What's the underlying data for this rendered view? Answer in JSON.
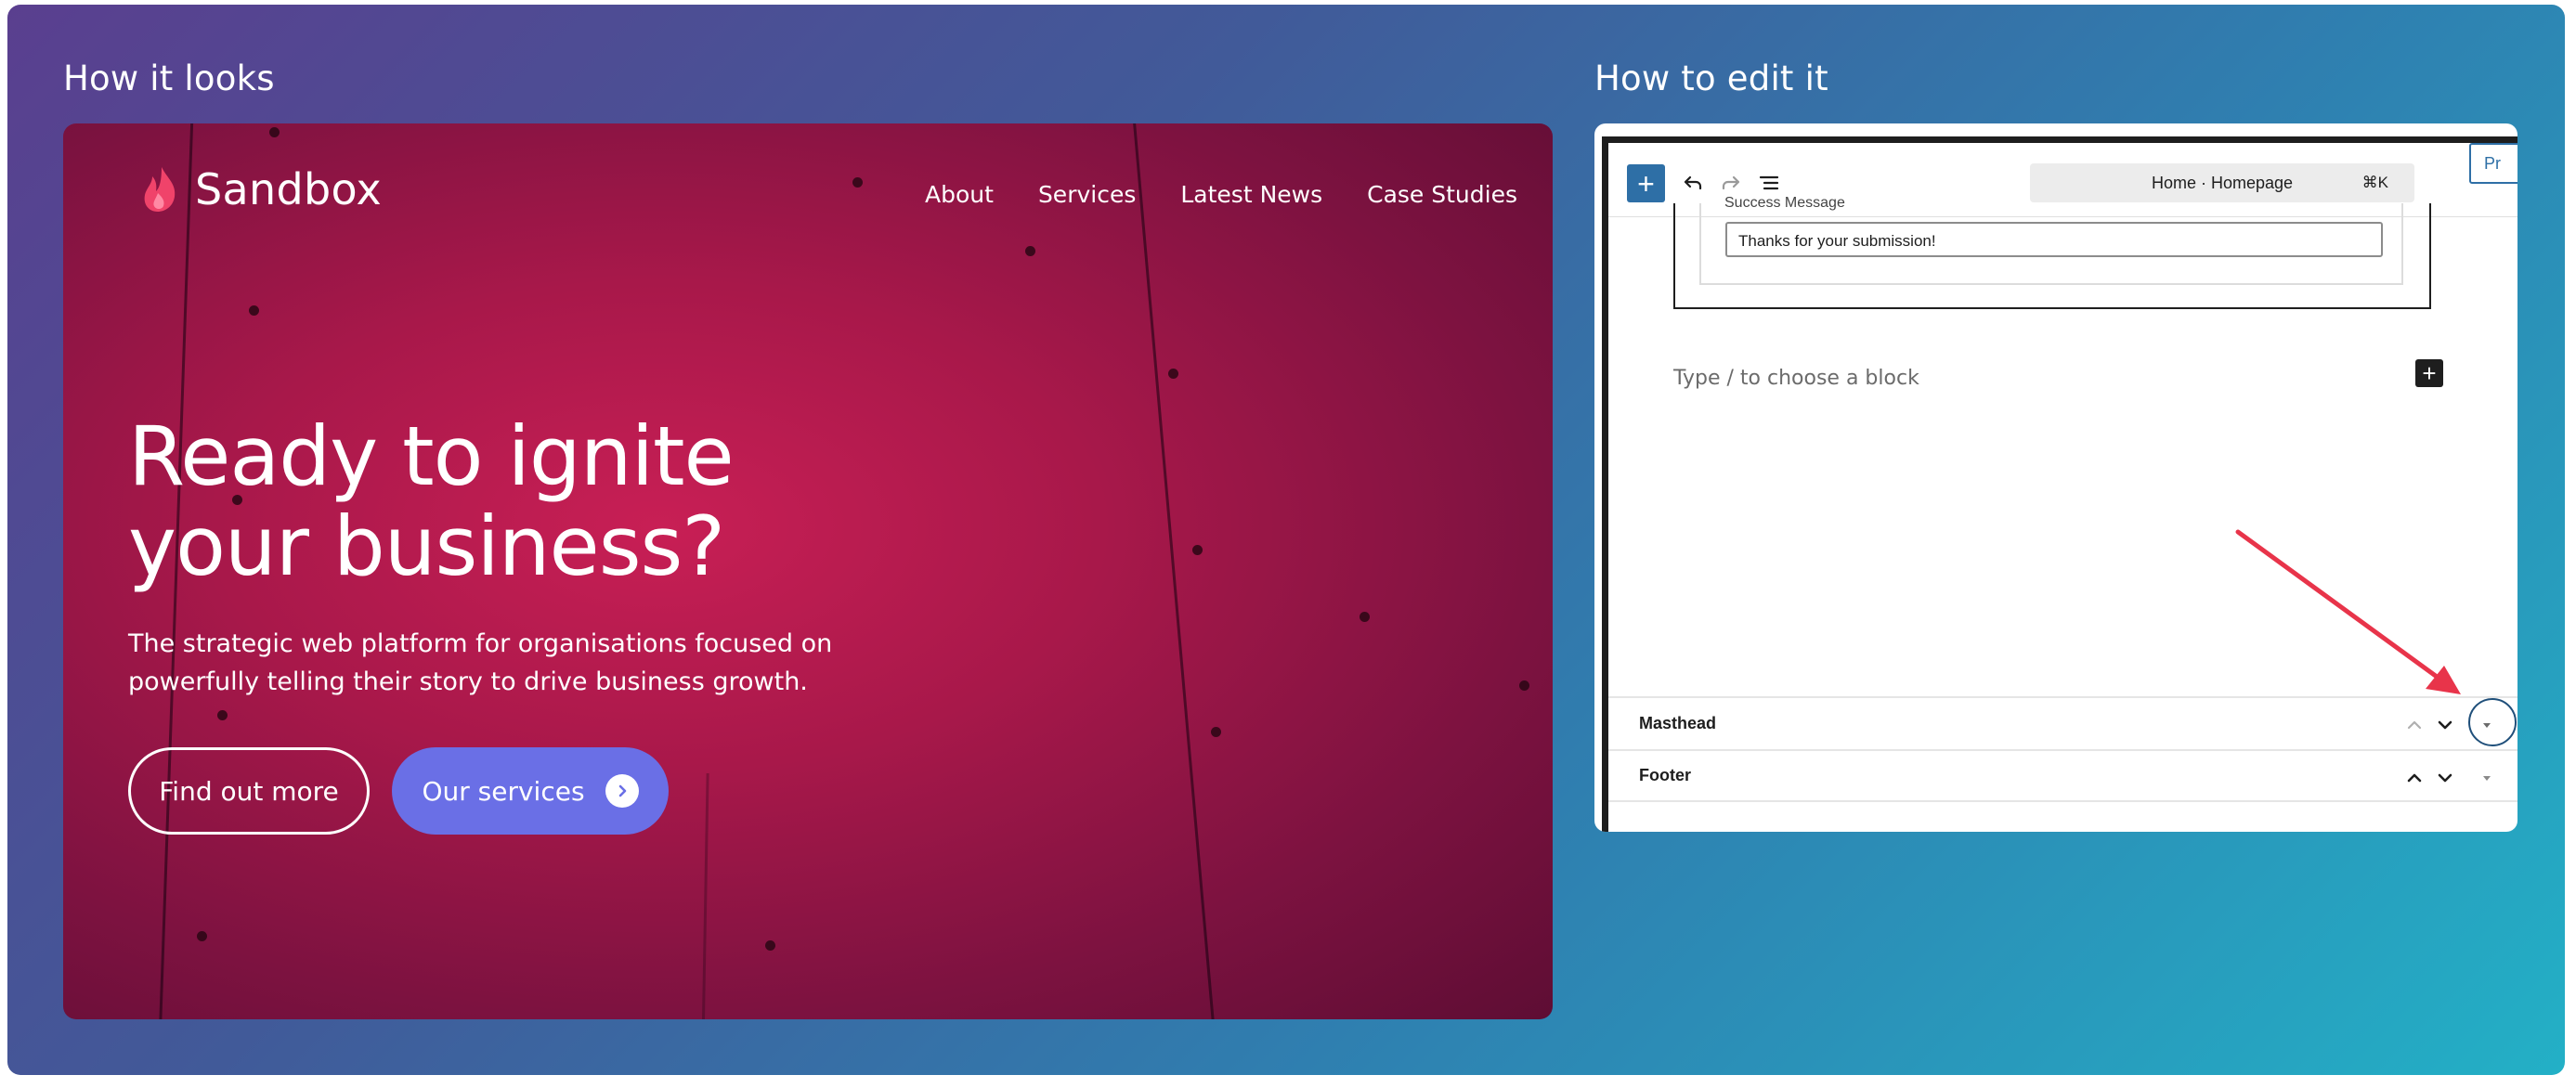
{
  "left_title": "How it looks",
  "right_title": "How to edit it",
  "site": {
    "brand": "Sandbox",
    "nav": [
      "About",
      "Services",
      "Latest News",
      "Case Studies"
    ],
    "hero_title_line1": "Ready to ignite",
    "hero_title_line2": "your business?",
    "hero_sub_line1": "The strategic web platform for organisations focused on",
    "hero_sub_line2": "powerfully telling their story to drive business growth.",
    "btn_primary": "Find out more",
    "btn_secondary": "Our services"
  },
  "editor": {
    "command_text": "Home · Homepage",
    "command_shortcut": "⌘K",
    "preview_partial": "Pr",
    "success_label": "Success Message",
    "success_value": "Thanks for your submission!",
    "block_placeholder": "Type / to choose a block",
    "rows": [
      "Masthead",
      "Footer"
    ]
  },
  "colors": {
    "accent_blue": "#2e6fa6",
    "button_purple": "#6a6fe6",
    "arrow_red": "#e8344a"
  }
}
